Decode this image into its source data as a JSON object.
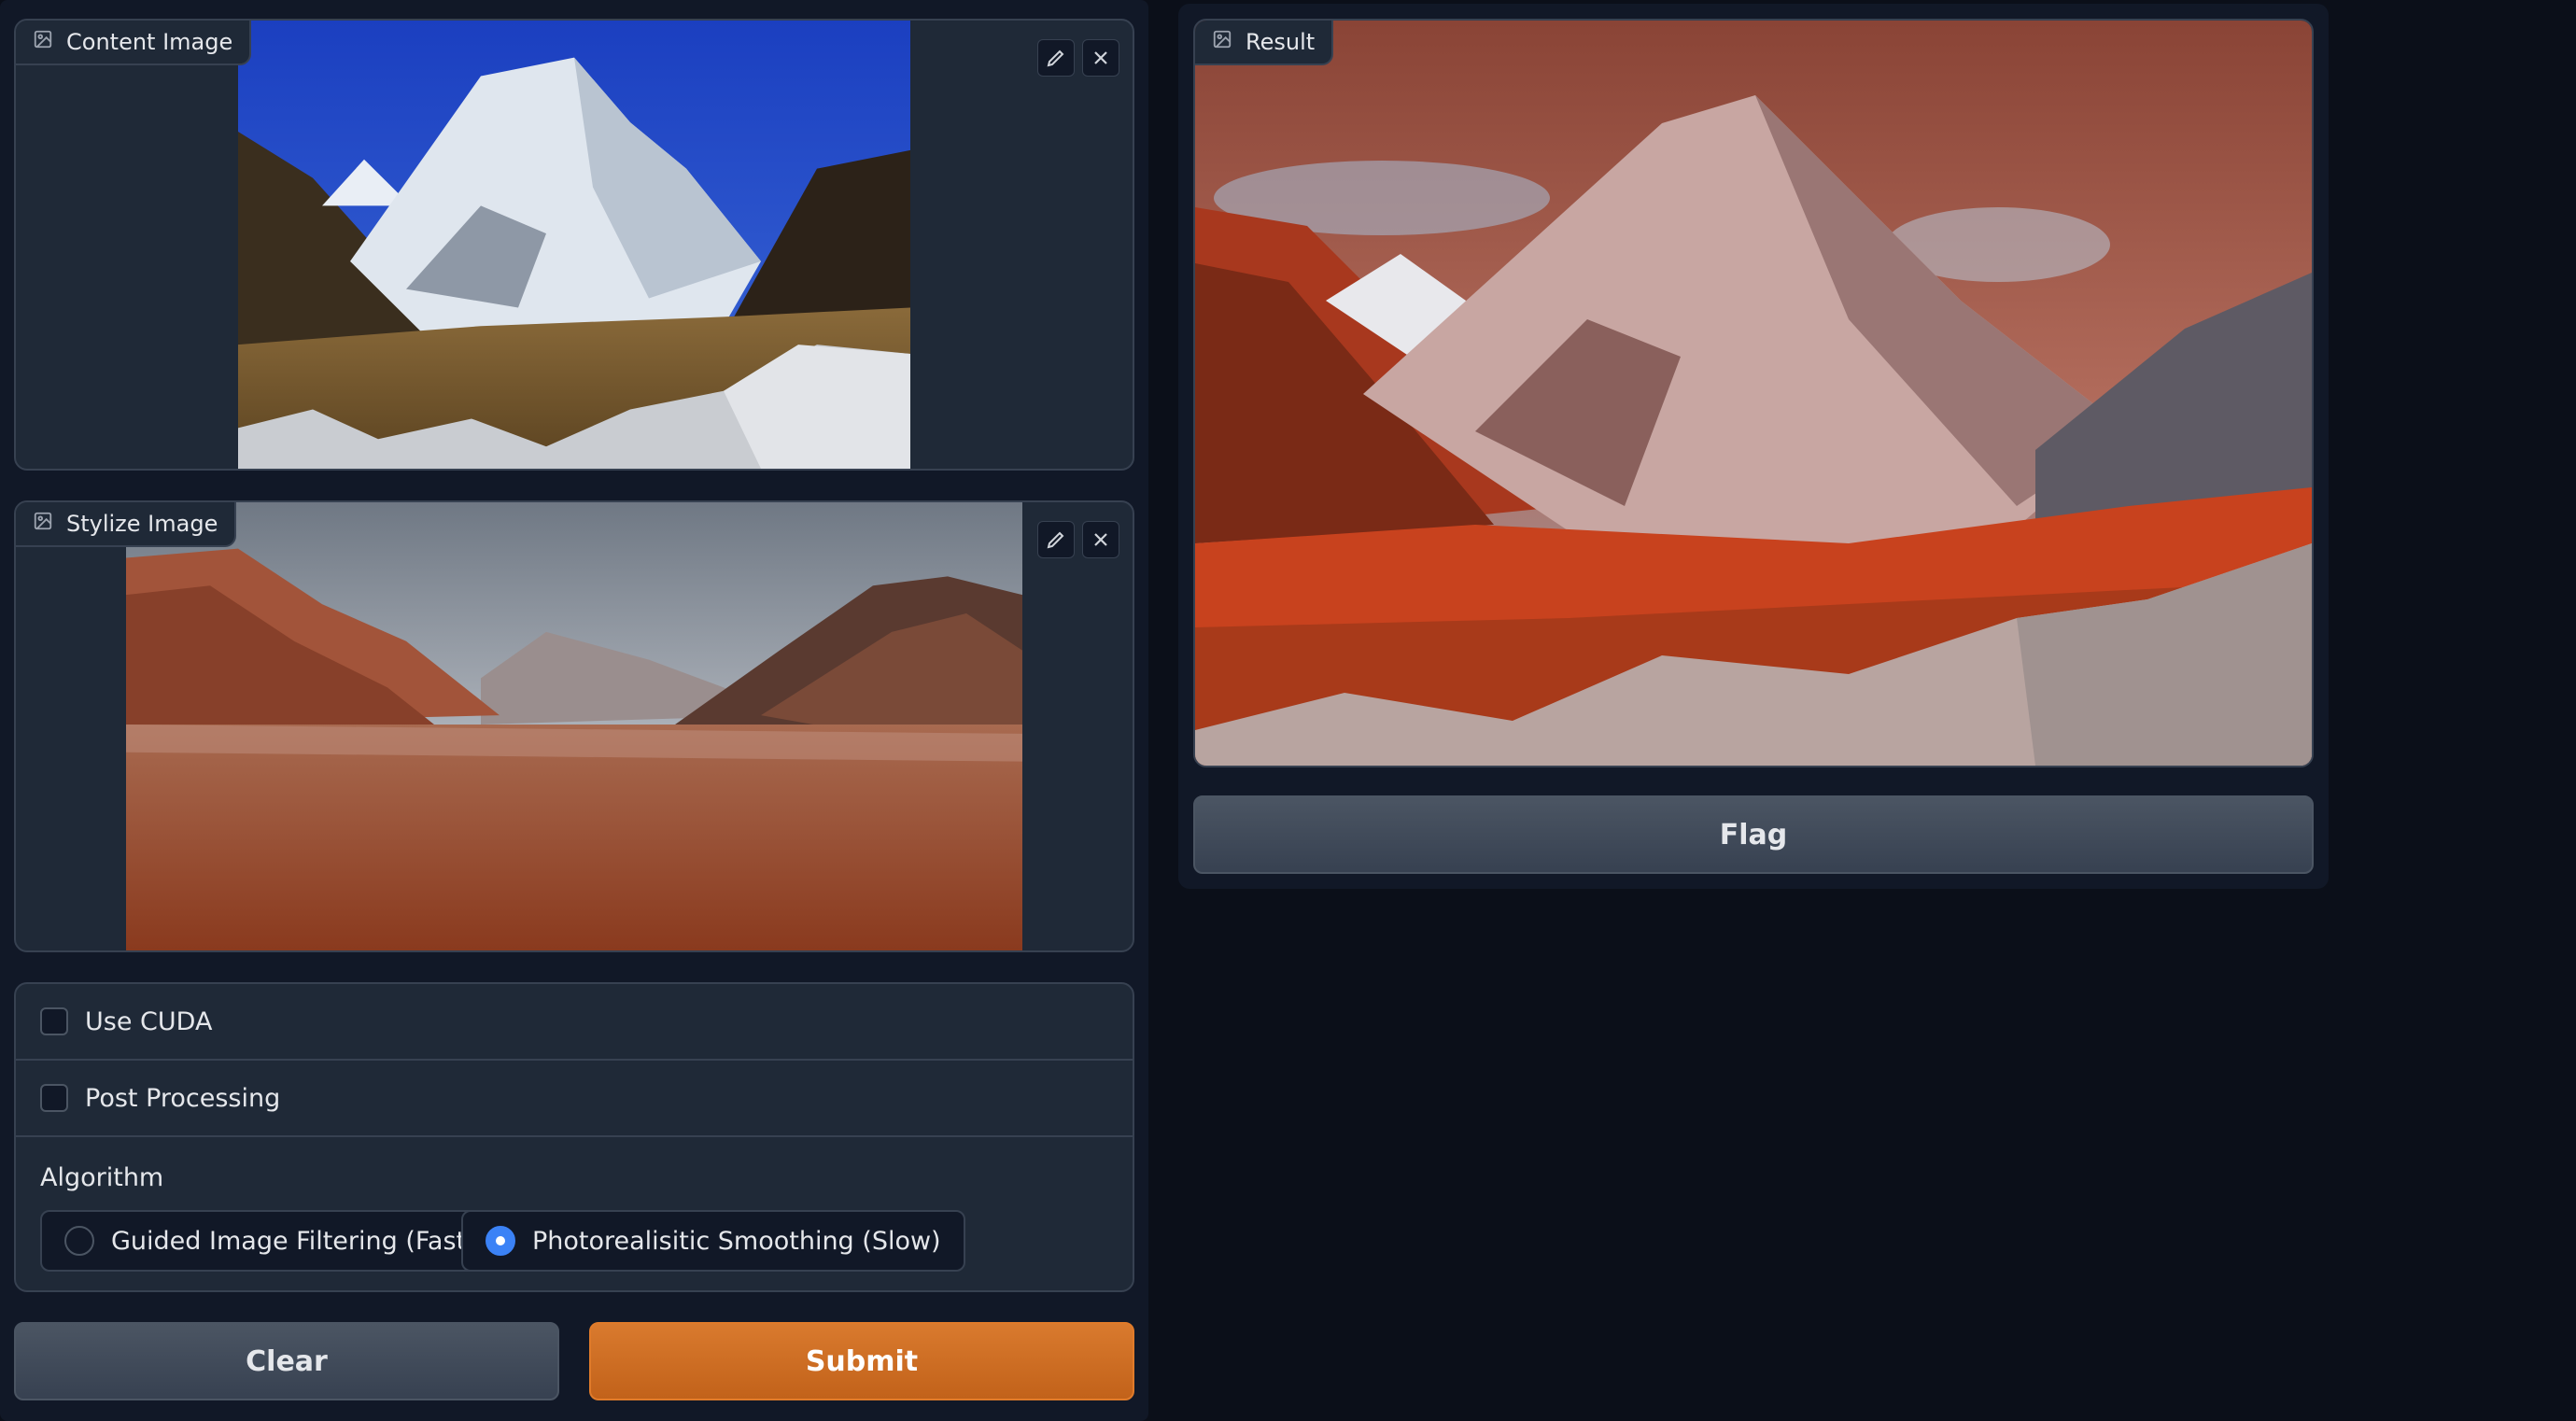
{
  "content_image": {
    "label": "Content Image",
    "icon": "image-icon",
    "edit_icon": "pencil-icon",
    "clear_icon": "close-icon"
  },
  "stylize_image": {
    "label": "Stylize Image",
    "icon": "image-icon",
    "edit_icon": "pencil-icon",
    "clear_icon": "close-icon"
  },
  "options": {
    "use_cuda": {
      "label": "Use CUDA",
      "checked": false
    },
    "post_processing": {
      "label": "Post Processing",
      "checked": false
    },
    "algorithm": {
      "label": "Algorithm",
      "choices": [
        {
          "label": "Guided Image Filtering (Fast)",
          "selected": false
        },
        {
          "label": "Photorealisitic Smoothing (Slow)",
          "selected": true
        }
      ]
    }
  },
  "buttons": {
    "clear": "Clear",
    "submit": "Submit",
    "flag": "Flag"
  },
  "result": {
    "label": "Result",
    "icon": "image-icon"
  },
  "colors": {
    "background": "#0b0f19",
    "panel": "#1f2937",
    "primary_button": "#c8661f",
    "radio_accent": "#3b82f6"
  }
}
